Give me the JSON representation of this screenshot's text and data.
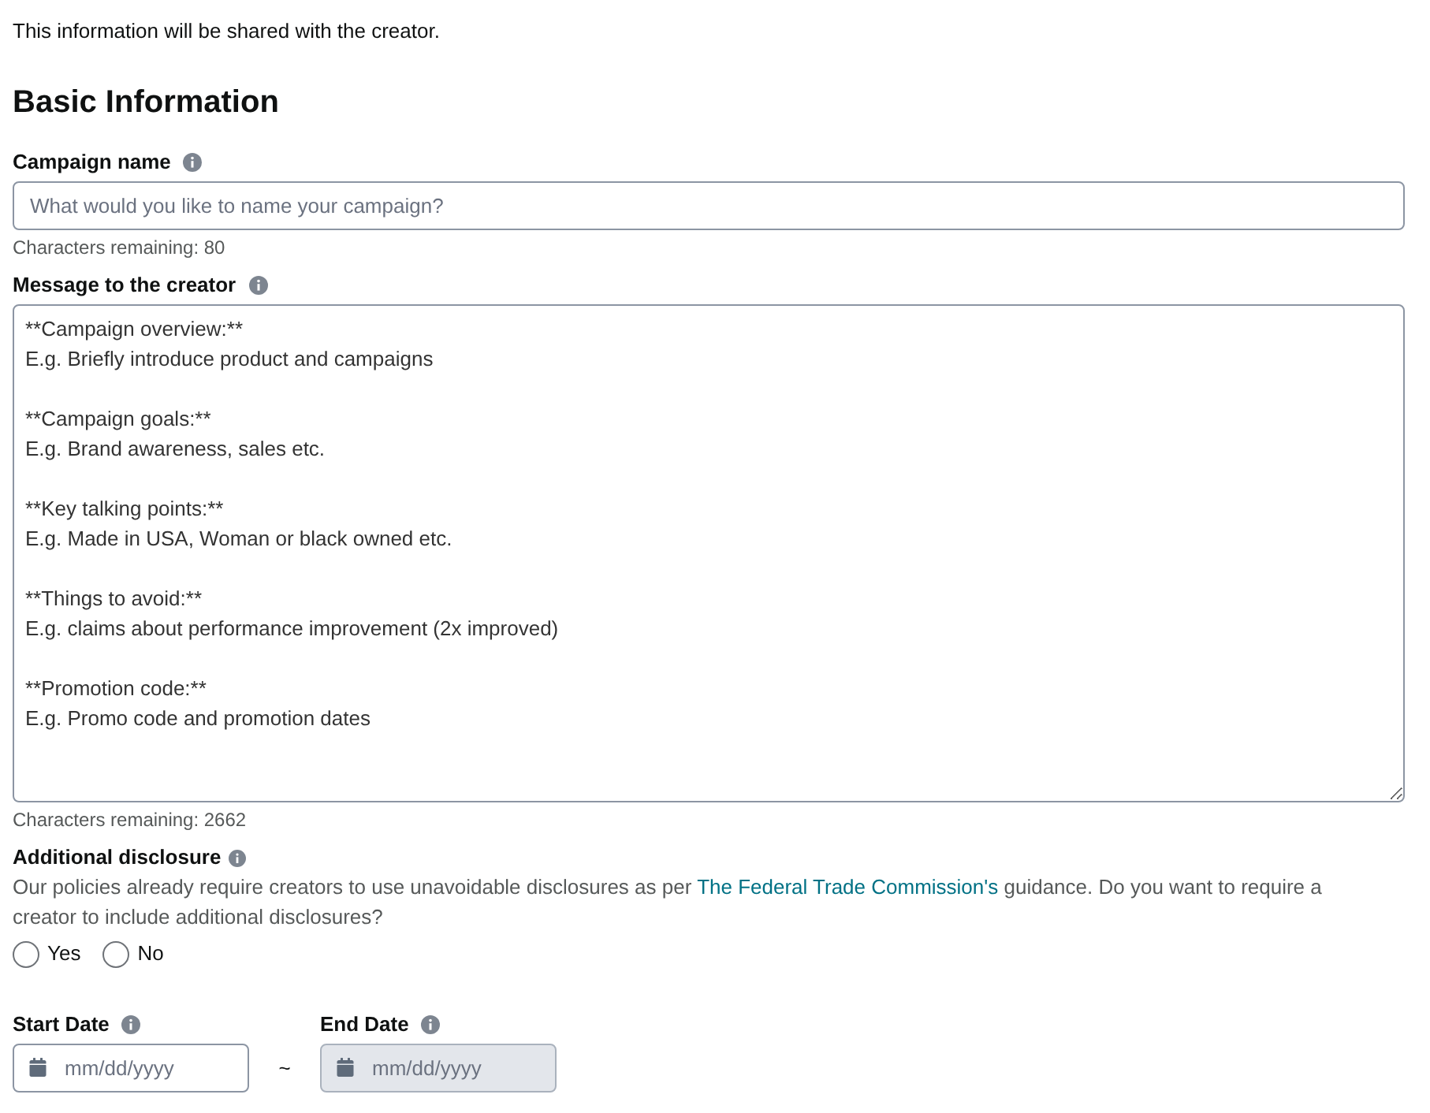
{
  "intro": "This information will be shared with the creator.",
  "section_title": "Basic Information",
  "campaign_name": {
    "label": "Campaign name",
    "placeholder": "What would you like to name your campaign?",
    "counter": "Characters remaining: 80"
  },
  "message": {
    "label": "Message to the creator",
    "sections": [
      {
        "heading": "**Campaign overview:**",
        "example": "E.g. Briefly introduce product and campaigns"
      },
      {
        "heading": "**Campaign goals:**",
        "example": "E.g. Brand awareness, sales etc."
      },
      {
        "heading": "**Key talking points:**",
        "example": "E.g. Made in USA, Woman or black owned etc."
      },
      {
        "heading": "**Things to avoid:**",
        "example": "E.g. claims about performance improvement (2x improved)"
      },
      {
        "heading": "**Promotion code:**",
        "example": "E.g. Promo code and promotion dates"
      }
    ],
    "counter": "Characters remaining: 2662"
  },
  "disclosure": {
    "label": "Additional disclosure",
    "text_before": "Our policies already require creators to use unavoidable disclosures as per",
    "link": "The Federal Trade Commission's",
    "text_after": "guidance. Do you want to require a creator to include additional disclosures?",
    "options": [
      {
        "label": "Yes",
        "selected": false
      },
      {
        "label": "No",
        "selected": false
      }
    ]
  },
  "date_fields": [
    {
      "label": "Start Date",
      "placeholder": "mm/dd/yyyy",
      "disabled": false
    },
    {
      "label": "End Date",
      "placeholder": "mm/dd/yyyy",
      "disabled": true
    }
  ],
  "date_separator": "~"
}
